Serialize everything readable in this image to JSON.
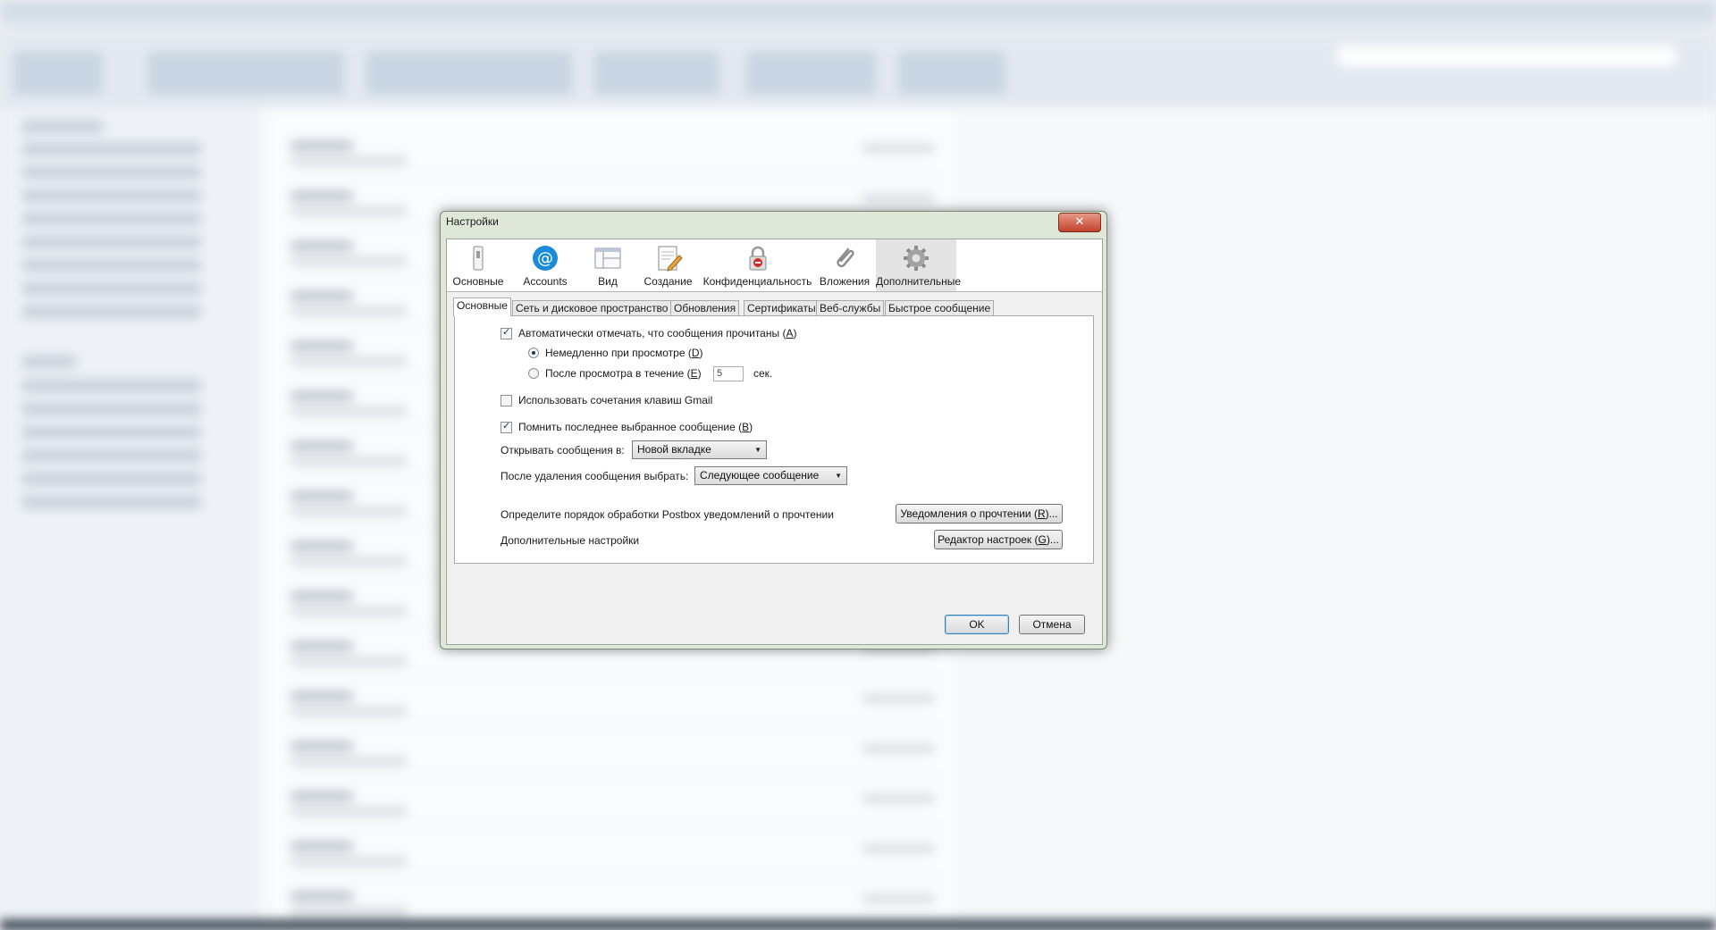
{
  "dialog": {
    "title": "Настройки",
    "close_label": "✕"
  },
  "panes": [
    {
      "label": "Основные",
      "icon": "switch-icon"
    },
    {
      "label": "Accounts",
      "icon": "at-sign-icon"
    },
    {
      "label": "Вид",
      "icon": "window-layout-icon"
    },
    {
      "label": "Создание",
      "icon": "compose-pencil-icon"
    },
    {
      "label": "Конфиденциальность",
      "icon": "padlock-icon"
    },
    {
      "label": "Вложения",
      "icon": "paperclip-icon"
    },
    {
      "label": "Дополнительные",
      "icon": "gear-icon"
    }
  ],
  "subtabs": [
    "Основные",
    "Сеть и дисковое пространство",
    "Обновления",
    "Сертификаты",
    "Веб-службы",
    "Быстрое сообщение"
  ],
  "settings": {
    "auto_mark_read": {
      "label": "Автоматически отмечать, что сообщения прочитаны",
      "key": "A",
      "checked": true
    },
    "immediately": {
      "label": "Немедленно при просмотре",
      "key": "D",
      "selected": true
    },
    "after_delay": {
      "label": "После просмотра в течение",
      "key": "E",
      "value": "5",
      "unit": "сек."
    },
    "gmail_shortcuts": {
      "label": "Использовать сочетания клавиш Gmail",
      "checked": false
    },
    "remember_last": {
      "label": "Помнить последнее выбранное сообщение",
      "key": "B",
      "checked": true
    },
    "open_in": {
      "label": "Открывать сообщения в:",
      "value": "Новой вкладке"
    },
    "after_delete": {
      "label": "После удаления сообщения выбрать:",
      "value": "Следующее сообщение"
    },
    "receipts": {
      "label": "Определите порядок обработки Postbox уведомлений о прочтении",
      "button": "Уведомления о прочтении",
      "key": "R"
    },
    "advanced": {
      "label": "Дополнительные настройки",
      "button": "Редактор настроек",
      "key": "G"
    }
  },
  "buttons": {
    "ok": "OK",
    "cancel": "Отмена"
  },
  "colors": {
    "accent": "#1a8bd8",
    "dialog_frame": "#dfe7d9"
  }
}
